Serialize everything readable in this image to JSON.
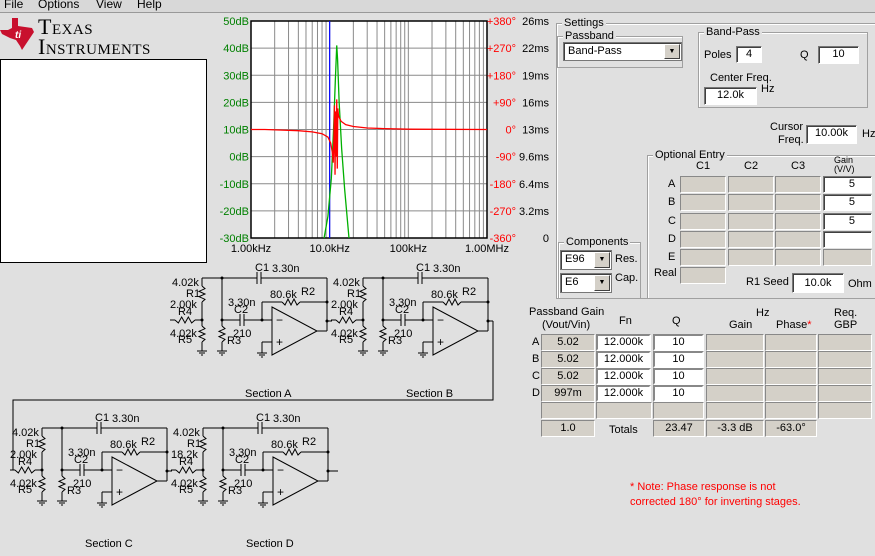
{
  "menu": [
    "File",
    "Options",
    "View",
    "Help"
  ],
  "logo": {
    "line1": "Texas",
    "line2": "Instruments"
  },
  "chart_data": {
    "type": "line",
    "title": "",
    "x_axis": {
      "scale": "log",
      "range": [
        1000,
        1000000
      ],
      "tick_labels": [
        "1.00kHz",
        "10.0kHz",
        "100kHz",
        "1.00MHz"
      ]
    },
    "y_left": {
      "range": [
        -30,
        50
      ],
      "unit": "dB",
      "tick_labels": [
        "50dB",
        "40dB",
        "30dB",
        "20dB",
        "10dB",
        "0dB",
        "-10dB",
        "-20dB",
        "-30dB"
      ]
    },
    "y_phase": {
      "tick_labels": [
        "+380°",
        "+270°",
        "+180°",
        "+90°",
        "0°",
        "-90°",
        "-180°",
        "-270°",
        "-360°"
      ]
    },
    "y_delay": {
      "tick_labels": [
        "26ms",
        "22ms",
        "19ms",
        "16ms",
        "13ms",
        "9.6ms",
        "6.4ms",
        "3.2ms",
        "0"
      ]
    },
    "grid": true,
    "cursor_freq": 10000,
    "series": [
      {
        "name": "Gain (dB)",
        "color": "#00b000",
        "x": [
          8500,
          9500,
          10500,
          11200,
          11800,
          12300,
          12600,
          13200,
          14200,
          15500,
          17600
        ],
        "y": [
          -30,
          -22,
          -8,
          10,
          28,
          41,
          36,
          20,
          3,
          -12,
          -30
        ]
      },
      {
        "name": "Phase (deg)",
        "color": "#ff0000",
        "x": [
          1000,
          1500,
          2500,
          4000,
          6000,
          8000,
          9500,
          10300,
          10800,
          11100,
          11300,
          11500,
          11700,
          11900,
          12100,
          12300,
          12500,
          12700,
          12900,
          13200,
          14000,
          16000,
          20000,
          30000,
          50000,
          100000,
          1000000
        ],
        "y": [
          0,
          0,
          -2,
          -4,
          -8,
          -14,
          -25,
          -45,
          -75,
          -110,
          -40,
          80,
          -150,
          60,
          -90,
          100,
          -130,
          70,
          50,
          40,
          27,
          16,
          10,
          5,
          3,
          1,
          0
        ]
      }
    ],
    "cursor_color": "#0000ff"
  },
  "settings": {
    "title": "Settings",
    "passband": {
      "title": "Passband",
      "value": "Band-Pass"
    },
    "bandpass": {
      "title": "Band-Pass",
      "poles_label": "Poles",
      "poles": "4",
      "q_label": "Q",
      "q": "10",
      "center_label": "Center Freq.",
      "center": "12.0k",
      "hz": "Hz"
    },
    "cursor": {
      "label1": "Cursor",
      "label2": "Freq.",
      "value": "10.00k",
      "hz": "Hz"
    },
    "components": {
      "title": "Components",
      "res": "E96",
      "res_label": "Res.",
      "cap": "E6",
      "cap_label": "Cap."
    },
    "optional": {
      "title": "Optional Entry",
      "cols": [
        "C1",
        "C2",
        "C3"
      ],
      "gain_label1": "Gain",
      "gain_label2": "(V/V)",
      "rows": [
        "A",
        "B",
        "C",
        "D",
        "E"
      ],
      "gains": [
        "5",
        "5",
        "5",
        "",
        ""
      ],
      "real_label": "Real",
      "seed_label": "R1 Seed",
      "seed": "10.0k",
      "ohm": "Ohm"
    }
  },
  "table": {
    "headers": {
      "gain1": "Passband Gain",
      "gain2": "(Vout/Vin)",
      "fn": "Fn",
      "q": "Q",
      "hz": "Hz",
      "gain": "Gain",
      "phase": "Phase",
      "star": "*",
      "gbp1": "Req.",
      "gbp2": "GBP"
    },
    "rows": [
      {
        "label": "A",
        "gain": "5.02",
        "fn": "12.000k",
        "q": "10"
      },
      {
        "label": "B",
        "gain": "5.02",
        "fn": "12.000k",
        "q": "10"
      },
      {
        "label": "C",
        "gain": "5.02",
        "fn": "12.000k",
        "q": "10"
      },
      {
        "label": "D",
        "gain": "997m",
        "fn": "12.000k",
        "q": "10"
      }
    ],
    "totals": {
      "gain": "1.0",
      "label": "Totals",
      "q": "23.47",
      "hz_gain": "-3.3 dB",
      "phase": "-63.0°"
    }
  },
  "note": {
    "line1": "* Note: Phase response is not",
    "line2": "corrected 180° for inverting stages."
  },
  "sections": [
    {
      "name": "Section A",
      "r1": "4.02k",
      "r4": "2.00k",
      "r5": "4.02k",
      "r3": "210",
      "c1": "3.30n",
      "c2": "3.30n",
      "r2": "80.6k"
    },
    {
      "name": "Section B",
      "r1": "4.02k",
      "r4": "2.00k",
      "r5": "4.02k",
      "r3": "210",
      "c1": "3.30n",
      "c2": "3.30n",
      "r2": "80.6k"
    },
    {
      "name": "Section C",
      "r1": "4.02k",
      "r4": "2.00k",
      "r5": "4.02k",
      "r3": "210",
      "c1": "3.30n",
      "c2": "3.30n",
      "r2": "80.6k"
    },
    {
      "name": "Section D",
      "r1": "4.02k",
      "r4": "18.2k",
      "r5": "4.02k",
      "r3": "210",
      "c1": "3.30n",
      "c2": "3.30n",
      "r2": "80.6k"
    }
  ],
  "designators": {
    "c1": "C1",
    "c2": "C2",
    "r1": "R1",
    "r2": "R2",
    "r3": "R3",
    "r4": "R4",
    "r5": "R5",
    "minus": "−",
    "plus": "+"
  }
}
